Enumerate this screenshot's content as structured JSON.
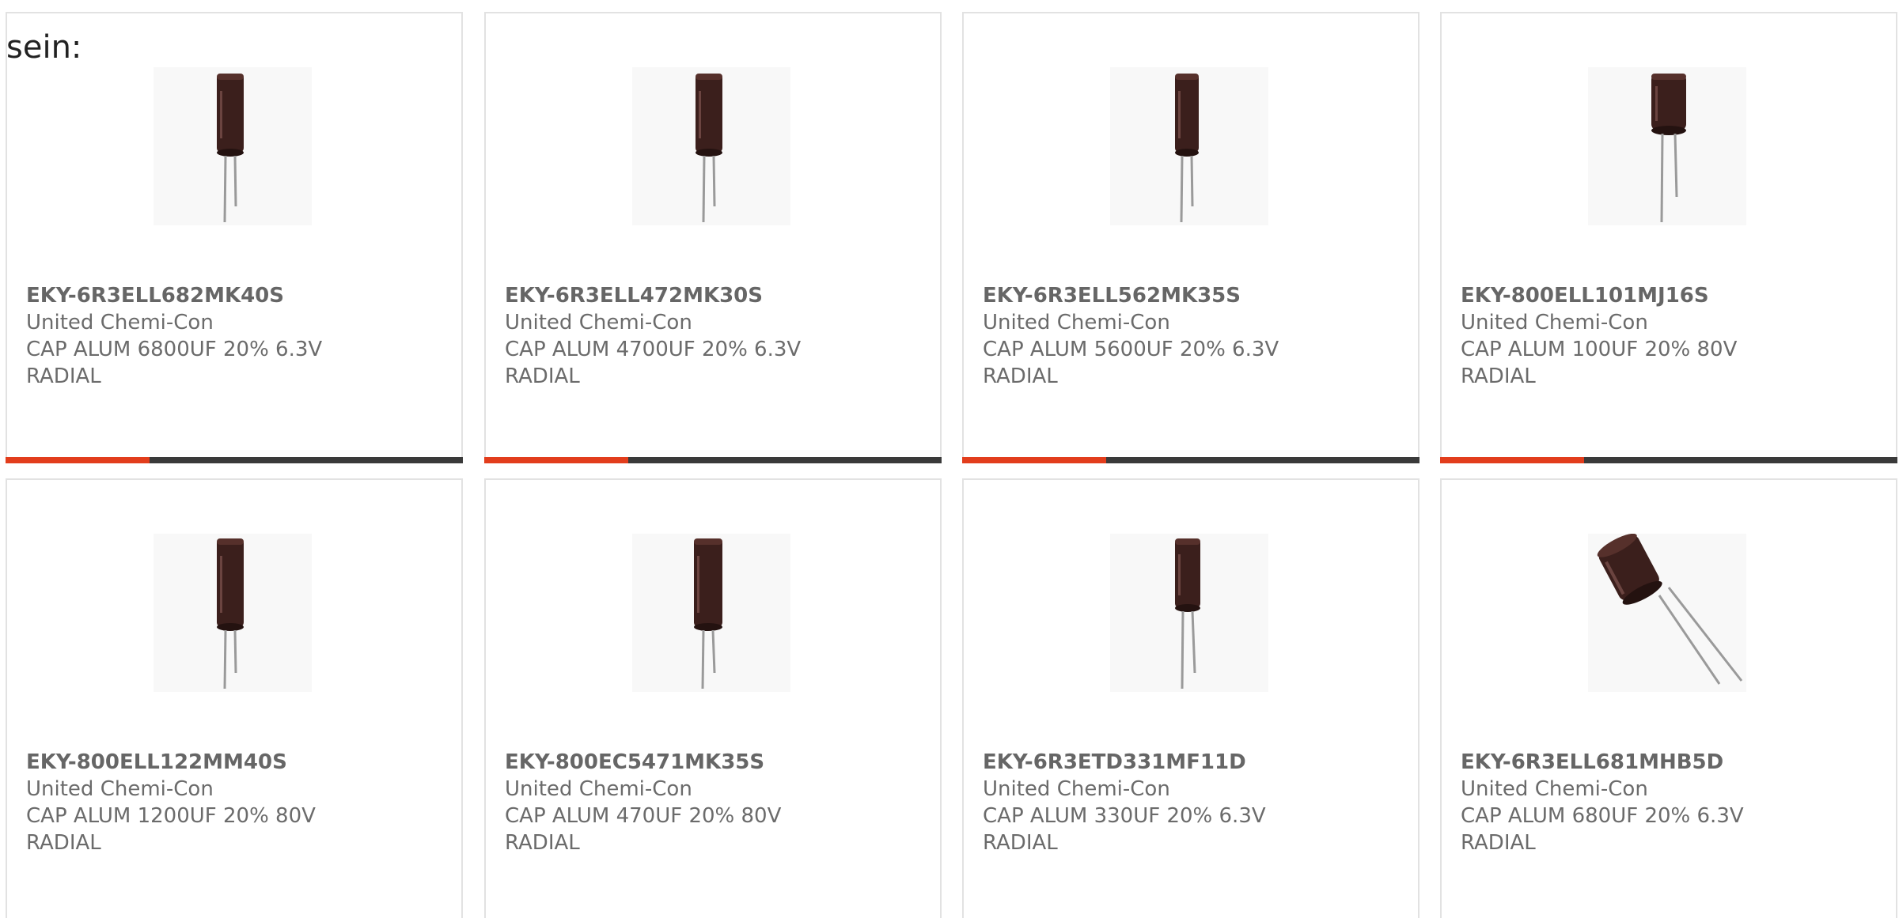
{
  "intro_text": "sein:",
  "colors": {
    "accent": "#e23d1c",
    "bar_dark": "#3a3a3a",
    "border": "#e2e2e2",
    "text": "#6b6b6b"
  },
  "products": [
    {
      "part_number": "EKY-6R3ELL682MK40S",
      "manufacturer": "United Chemi-Con",
      "desc1": "CAP ALUM 6800UF 20% 6.3V",
      "desc2": "RADIAL",
      "image": "radial-capacitor-upright"
    },
    {
      "part_number": "EKY-6R3ELL472MK30S",
      "manufacturer": "United Chemi-Con",
      "desc1": "CAP ALUM 4700UF 20% 6.3V",
      "desc2": "RADIAL",
      "image": "radial-capacitor-upright"
    },
    {
      "part_number": "EKY-6R3ELL562MK35S",
      "manufacturer": "United Chemi-Con",
      "desc1": "CAP ALUM 5600UF 20% 6.3V",
      "desc2": "RADIAL",
      "image": "radial-capacitor-upright"
    },
    {
      "part_number": "EKY-800ELL101MJ16S",
      "manufacturer": "United Chemi-Con",
      "desc1": "CAP ALUM 100UF 20% 80V",
      "desc2": "RADIAL",
      "image": "radial-capacitor-upright"
    },
    {
      "part_number": "EKY-800ELL122MM40S",
      "manufacturer": "United Chemi-Con",
      "desc1": "CAP ALUM 1200UF 20% 80V",
      "desc2": "RADIAL",
      "image": "radial-capacitor-upright"
    },
    {
      "part_number": "EKY-800EC5471MK35S",
      "manufacturer": "United Chemi-Con",
      "desc1": "CAP ALUM 470UF 20% 80V",
      "desc2": "RADIAL",
      "image": "radial-capacitor-upright"
    },
    {
      "part_number": "EKY-6R3ETD331MF11D",
      "manufacturer": "United Chemi-Con",
      "desc1": "CAP ALUM 330UF 20% 6.3V",
      "desc2": "RADIAL",
      "image": "radial-capacitor-upright"
    },
    {
      "part_number": "EKY-6R3ELL681MHB5D",
      "manufacturer": "United Chemi-Con",
      "desc1": "CAP ALUM 680UF 20% 6.3V",
      "desc2": "RADIAL",
      "image": "radial-capacitor-tilted"
    }
  ]
}
